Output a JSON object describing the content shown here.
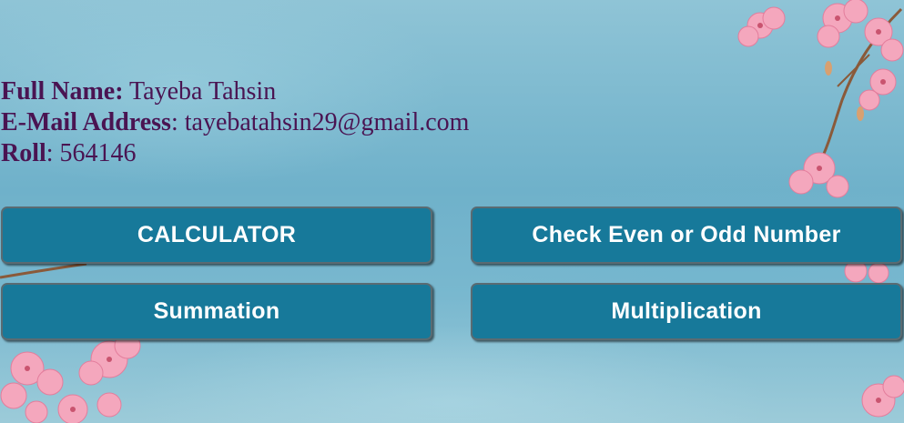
{
  "profile": {
    "name_label": "Full Name:",
    "name_value": " Tayeba Tahsin",
    "email_label": "E-Mail Address",
    "email_value": ": tayebatahsin29@gmail.com",
    "roll_label": "Roll",
    "roll_value": ": 564146"
  },
  "buttons": {
    "calculator": "CALCULATOR",
    "even_odd": "Check Even or Odd Number",
    "summation": "Summation",
    "multiplication": "Multiplication"
  },
  "colors": {
    "text": "#4a1452",
    "button": "#17799a",
    "button_text": "#ffffff"
  }
}
